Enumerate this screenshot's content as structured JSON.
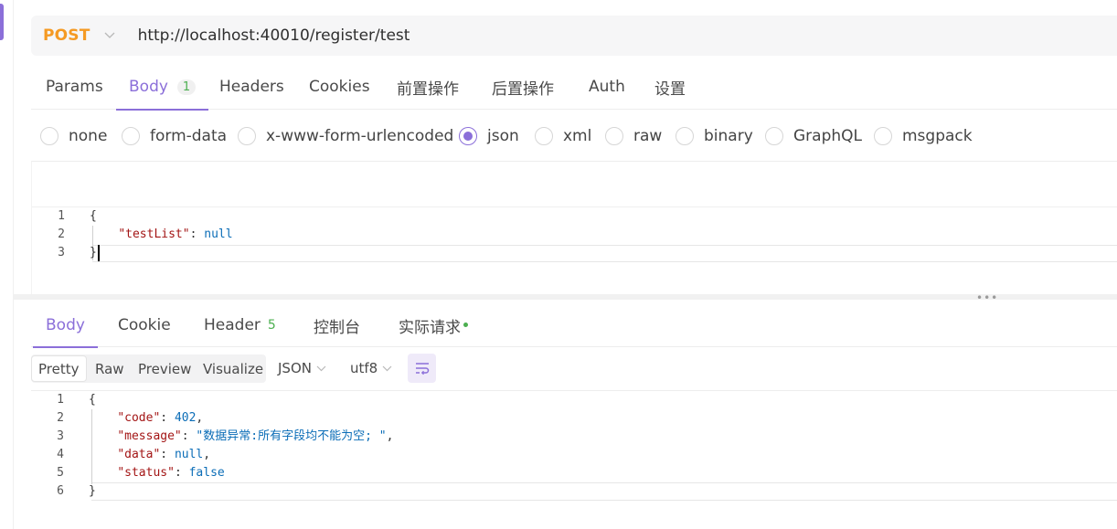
{
  "request": {
    "method": "POST",
    "url": "http://localhost:40010/register/test"
  },
  "request_tabs": [
    {
      "label": "Params"
    },
    {
      "label": "Body",
      "badge": "1",
      "active": true
    },
    {
      "label": "Headers"
    },
    {
      "label": "Cookies"
    },
    {
      "label": "前置操作"
    },
    {
      "label": "后置操作"
    },
    {
      "label": "Auth"
    },
    {
      "label": "设置"
    }
  ],
  "body_types": [
    {
      "label": "none"
    },
    {
      "label": "form-data"
    },
    {
      "label": "x-www-form-urlencoded"
    },
    {
      "label": "json",
      "checked": true
    },
    {
      "label": "xml"
    },
    {
      "label": "raw"
    },
    {
      "label": "binary"
    },
    {
      "label": "GraphQL"
    },
    {
      "label": "msgpack"
    }
  ],
  "request_body": {
    "line_numbers": [
      "1",
      "2",
      "3"
    ],
    "lines": [
      [
        {
          "t": "{",
          "c": "p"
        }
      ],
      [
        {
          "t": "    ",
          "c": "p"
        },
        {
          "t": "\"testList\"",
          "c": "k"
        },
        {
          "t": ": ",
          "c": "p"
        },
        {
          "t": "null",
          "c": "n"
        }
      ],
      [
        {
          "t": "}",
          "c": "p"
        }
      ]
    ]
  },
  "response_tabs": [
    {
      "label": "Body",
      "active": true
    },
    {
      "label": "Cookie"
    },
    {
      "label": "Header",
      "badge": "5"
    },
    {
      "label": "控制台"
    },
    {
      "label": "实际请求",
      "dot": true
    }
  ],
  "response_toolbar": {
    "view_modes": [
      "Pretty",
      "Raw",
      "Preview",
      "Visualize"
    ],
    "active_view": "Pretty",
    "format": "JSON",
    "encoding": "utf8"
  },
  "response_body": {
    "line_numbers": [
      "1",
      "2",
      "3",
      "4",
      "5",
      "6"
    ],
    "lines": [
      [
        {
          "t": "{",
          "c": "p"
        }
      ],
      [
        {
          "t": "    ",
          "c": "p"
        },
        {
          "t": "\"code\"",
          "c": "k"
        },
        {
          "t": ": ",
          "c": "p"
        },
        {
          "t": "402",
          "c": "n"
        },
        {
          "t": ",",
          "c": "p"
        }
      ],
      [
        {
          "t": "    ",
          "c": "p"
        },
        {
          "t": "\"message\"",
          "c": "k"
        },
        {
          "t": ": ",
          "c": "p"
        },
        {
          "t": "\"数据异常:所有字段均不能为空; \"",
          "c": "s"
        },
        {
          "t": ",",
          "c": "p"
        }
      ],
      [
        {
          "t": "    ",
          "c": "p"
        },
        {
          "t": "\"data\"",
          "c": "k"
        },
        {
          "t": ": ",
          "c": "p"
        },
        {
          "t": "null",
          "c": "n"
        },
        {
          "t": ",",
          "c": "p"
        }
      ],
      [
        {
          "t": "    ",
          "c": "p"
        },
        {
          "t": "\"status\"",
          "c": "k"
        },
        {
          "t": ": ",
          "c": "p"
        },
        {
          "t": "false",
          "c": "n"
        }
      ],
      [
        {
          "t": "}",
          "c": "p"
        }
      ]
    ]
  },
  "icons": {
    "method_dropdown": "chevron-down-icon",
    "wrap_toggle": "wrap-lines-icon",
    "splitter": "drag-handle-icon"
  },
  "colors": {
    "accent": "#8b6fd9",
    "method": "#f59a23",
    "badge": "#4caf50"
  }
}
